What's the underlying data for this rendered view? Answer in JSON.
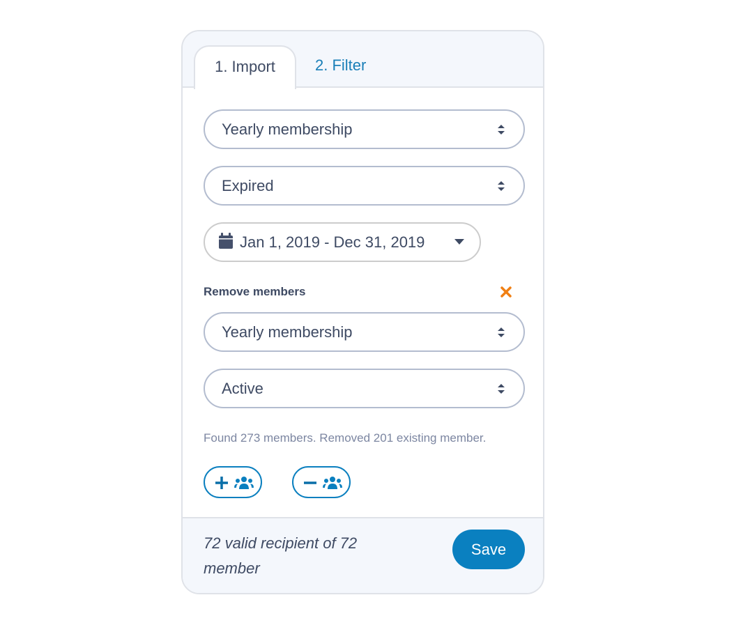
{
  "tabs": [
    {
      "label": "1. Import",
      "active": true
    },
    {
      "label": "2. Filter",
      "active": false
    }
  ],
  "import": {
    "membership_select": "Yearly membership",
    "status_select": "Expired",
    "date_range": "Jan 1, 2019 - Dec 31, 2019"
  },
  "remove": {
    "label": "Remove members",
    "membership_select": "Yearly membership",
    "status_select": "Active"
  },
  "status_text": "Found 273 members. Removed 201 existing member.",
  "actions": {
    "add_members": "add-members",
    "remove_members": "remove-members"
  },
  "footer": {
    "summary": "72 valid recipient of 72 member",
    "save_label": "Save"
  },
  "colors": {
    "accent": "#0a80c0",
    "close": "#f07f13",
    "text": "#3e4a63"
  }
}
